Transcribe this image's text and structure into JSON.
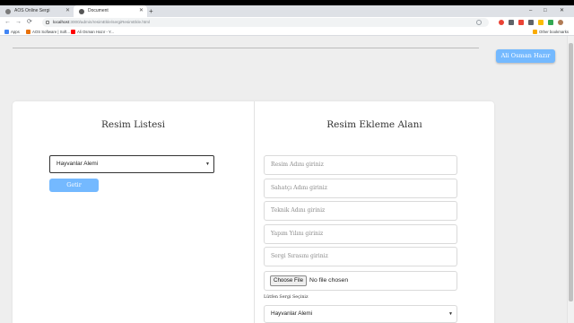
{
  "browser": {
    "tabs": [
      {
        "label": "AOS Online Sergi"
      },
      {
        "label": "Document"
      }
    ],
    "new_tab": "+",
    "window_controls": {
      "minimize": "–",
      "maximize": "□",
      "close": "✕"
    },
    "nav": {
      "back": "←",
      "forward": "→",
      "reload": "⟳"
    },
    "url": {
      "host": "localhost",
      "path": ":3000/admin/resimEkle/sergiResimEkle.html"
    },
    "bookmarks": [
      {
        "label": "Apps",
        "icon": "apps-grid-icon",
        "color": "#4285f4"
      },
      {
        "label": "AOS Software | Soft...",
        "icon": "bookmark-favicon",
        "color": "#e8710a"
      },
      {
        "label": "Ali Osman Hazır - Y...",
        "icon": "youtube-icon",
        "color": "#ff0000"
      }
    ],
    "other_bookmarks": "Other bookmarks",
    "extension_colors": [
      "#9aa0a6",
      "#9aa0a6",
      "#ea4335",
      "#5f6368",
      "#ea4335",
      "#5f6368",
      "#fbbc04",
      "#34a853",
      "#5f6368",
      "#1a73e8",
      "#80868b"
    ]
  },
  "header": {
    "user_name": "Ali Osman Hazır"
  },
  "left_panel": {
    "title": "Resim Listesi",
    "select_value": "Hayvanlar Alemi",
    "button": "Getir"
  },
  "right_panel": {
    "title": "Resim Ekleme Alanı",
    "placeholders": {
      "resim_adi": "Resim Adını giriniz",
      "sahatci_adi": "Sahatçı Adını giriniz",
      "teknik_adi": "Teknik Adını giriniz",
      "yapim_yili": "Yapım Yılını giriniz",
      "sergi_sirasi": "Sergi Sırasını giriniz"
    },
    "file": {
      "button": "Choose File",
      "status": "No file chosen"
    },
    "sergi_label": "Lütfen Sergi Seçiniz",
    "sergi_value": "Hayvanlar Alemi"
  },
  "colors": {
    "accent": "#74b9ff",
    "page_bg": "#eeeeee"
  }
}
